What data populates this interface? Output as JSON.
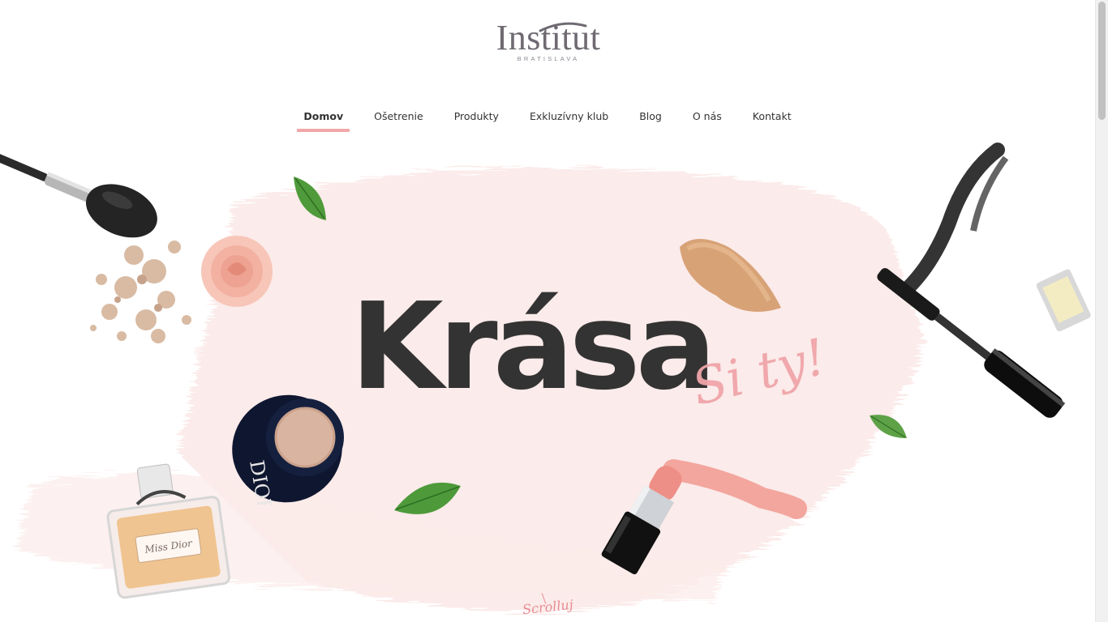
{
  "brand": {
    "name": "Institut",
    "subtitle": "BRATISLAVA"
  },
  "nav": {
    "items": [
      {
        "label": "Domov",
        "active": true
      },
      {
        "label": "Ošetrenie",
        "active": false
      },
      {
        "label": "Produkty",
        "active": false
      },
      {
        "label": "Exkluzívny klub",
        "active": false
      },
      {
        "label": "Blog",
        "active": false
      },
      {
        "label": "O nás",
        "active": false
      },
      {
        "label": "Kontakt",
        "active": false
      }
    ]
  },
  "hero": {
    "title": "Krása",
    "script": "Si ty!",
    "scroll_hint": "Scrolluj"
  },
  "decor": {
    "compact_brand": "DIOR",
    "perfume_label": "Miss Dior"
  },
  "colors": {
    "accent_pink": "#f2a7a9",
    "text_dark": "#333333",
    "brush_blush": "#fbeceb"
  }
}
